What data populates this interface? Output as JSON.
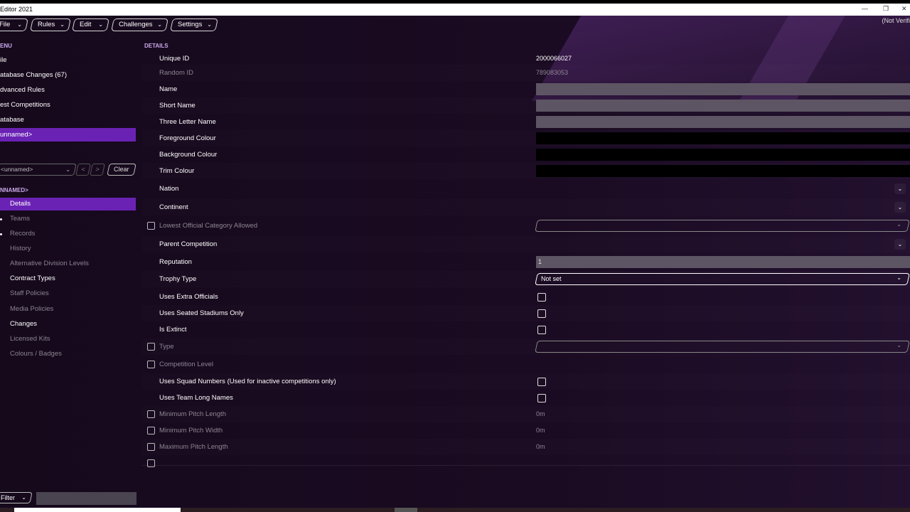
{
  "window": {
    "title": "Editor 2021",
    "min_icon": "minimize-icon",
    "restore_icon": "restore-icon",
    "close_icon": "close-icon"
  },
  "menubar": {
    "items": [
      {
        "label": "File"
      },
      {
        "label": "Rules"
      },
      {
        "label": "Edit"
      },
      {
        "label": "Challenges"
      },
      {
        "label": "Settings"
      }
    ],
    "status": "(Not Verifi"
  },
  "sidebar": {
    "menu_heading": "ENU",
    "items": [
      {
        "label": "ile"
      },
      {
        "label": "atabase Changes (67)"
      },
      {
        "label": "dvanced Rules"
      },
      {
        "label": "est Competitions"
      },
      {
        "label": "atabase"
      },
      {
        "label": "unnamed>"
      }
    ],
    "selector_value": "<unnamed>",
    "prev_label": "<",
    "next_label": ">",
    "clear_label": "Clear",
    "section_heading": "NNAMED>",
    "sub_items": [
      {
        "label": "Details"
      },
      {
        "label": "Teams"
      },
      {
        "label": "Records"
      },
      {
        "label": "History"
      },
      {
        "label": "Alternative Division Levels"
      },
      {
        "label": "Contract Types"
      },
      {
        "label": "Staff Policies"
      },
      {
        "label": "Media Policies"
      },
      {
        "label": "Changes"
      },
      {
        "label": "Licensed Kits"
      },
      {
        "label": "Colours / Badges"
      }
    ],
    "filter_label": "Filter"
  },
  "details": {
    "heading": "DETAILS",
    "unique_id": {
      "label": "Unique ID",
      "value": "2000066027"
    },
    "random_id": {
      "label": "Random ID",
      "value": "789083053"
    },
    "name": {
      "label": "Name"
    },
    "short_name": {
      "label": "Short Name"
    },
    "three_letter_name": {
      "label": "Three Letter Name"
    },
    "foreground_colour": {
      "label": "Foreground Colour"
    },
    "background_colour": {
      "label": "Background Colour"
    },
    "trim_colour": {
      "label": "Trim Colour"
    },
    "nation": {
      "label": "Nation"
    },
    "continent": {
      "label": "Continent"
    },
    "lowest_official_category": {
      "label": "Lowest Official Category Allowed"
    },
    "parent_competition": {
      "label": "Parent Competition"
    },
    "reputation": {
      "label": "Reputation",
      "value": "1"
    },
    "trophy_type": {
      "label": "Trophy Type",
      "value": "Not set"
    },
    "uses_extra_officials": {
      "label": "Uses Extra Officials"
    },
    "uses_seated_stadiums": {
      "label": "Uses Seated Stadiums Only"
    },
    "is_extinct": {
      "label": "Is Extinct"
    },
    "type": {
      "label": "Type"
    },
    "competition_level": {
      "label": "Competition Level"
    },
    "uses_squad_numbers": {
      "label": "Uses Squad Numbers (Used for inactive competitions only)"
    },
    "uses_team_long_names": {
      "label": "Uses Team Long Names"
    },
    "min_pitch_length": {
      "label": "Minimum Pitch Length",
      "value": "0m"
    },
    "min_pitch_width": {
      "label": "Minimum Pitch Width",
      "value": "0m"
    },
    "max_pitch_length": {
      "label": "Maximum Pitch Length",
      "value": "0m"
    }
  }
}
